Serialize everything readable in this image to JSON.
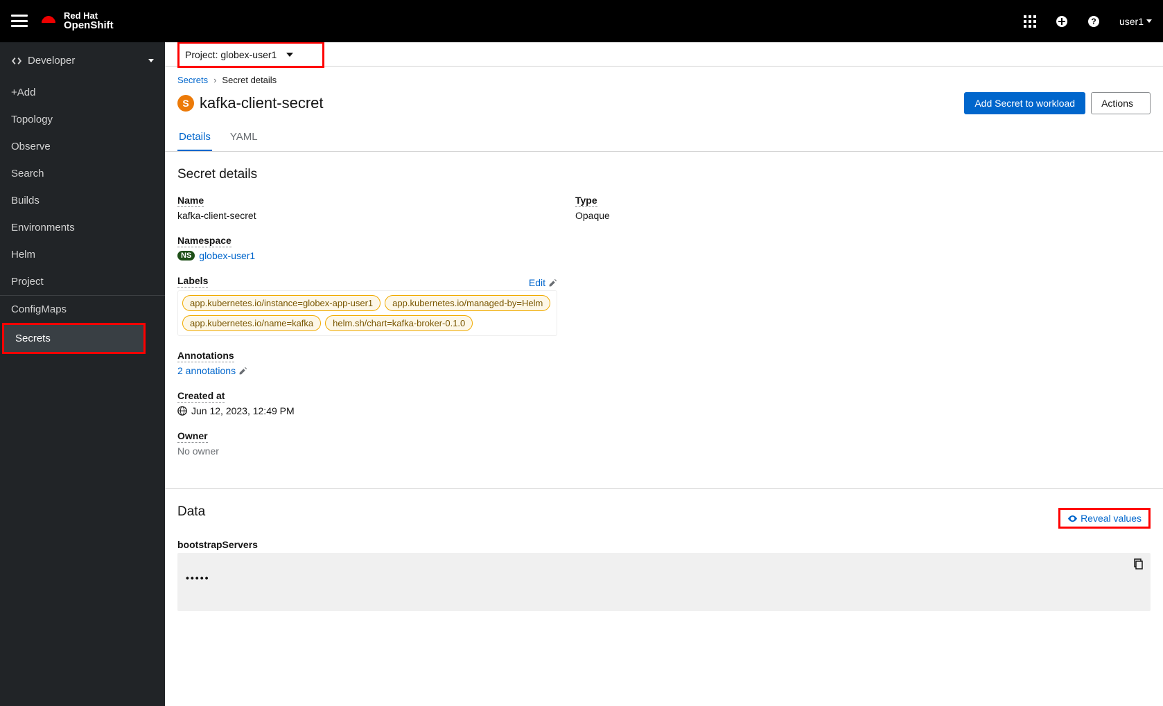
{
  "brand": {
    "line1": "Red Hat",
    "line2": "OpenShift"
  },
  "user": "user1",
  "sidebar": {
    "perspective": "Developer",
    "items": [
      "+Add",
      "Topology",
      "Observe",
      "Search",
      "Builds",
      "Environments",
      "Helm",
      "Project",
      "ConfigMaps",
      "Secrets"
    ]
  },
  "project": {
    "prefix": "Project:",
    "name": "globex-user1"
  },
  "breadcrumb": {
    "root": "Secrets",
    "current": "Secret details"
  },
  "resource": {
    "badge": "S",
    "name": "kafka-client-secret"
  },
  "actions": {
    "addToWorkload": "Add Secret to workload",
    "menu": "Actions"
  },
  "tabs": [
    "Details",
    "YAML"
  ],
  "details": {
    "heading": "Secret details",
    "name_label": "Name",
    "name_value": "kafka-client-secret",
    "namespace_label": "Namespace",
    "namespace_badge": "NS",
    "namespace_value": "globex-user1",
    "labels_label": "Labels",
    "edit": "Edit",
    "label_chips": [
      "app.kubernetes.io/instance=globex-app-user1",
      "app.kubernetes.io/managed-by=Helm",
      "app.kubernetes.io/name=kafka",
      "helm.sh/chart=kafka-broker-0.1.0"
    ],
    "annotations_label": "Annotations",
    "annotations_link": "2 annotations",
    "created_label": "Created at",
    "created_value": "Jun 12, 2023, 12:49 PM",
    "owner_label": "Owner",
    "owner_value": "No owner",
    "type_label": "Type",
    "type_value": "Opaque"
  },
  "data": {
    "heading": "Data",
    "reveal": "Reveal values",
    "key1": "bootstrapServers",
    "masked": "•••••"
  }
}
